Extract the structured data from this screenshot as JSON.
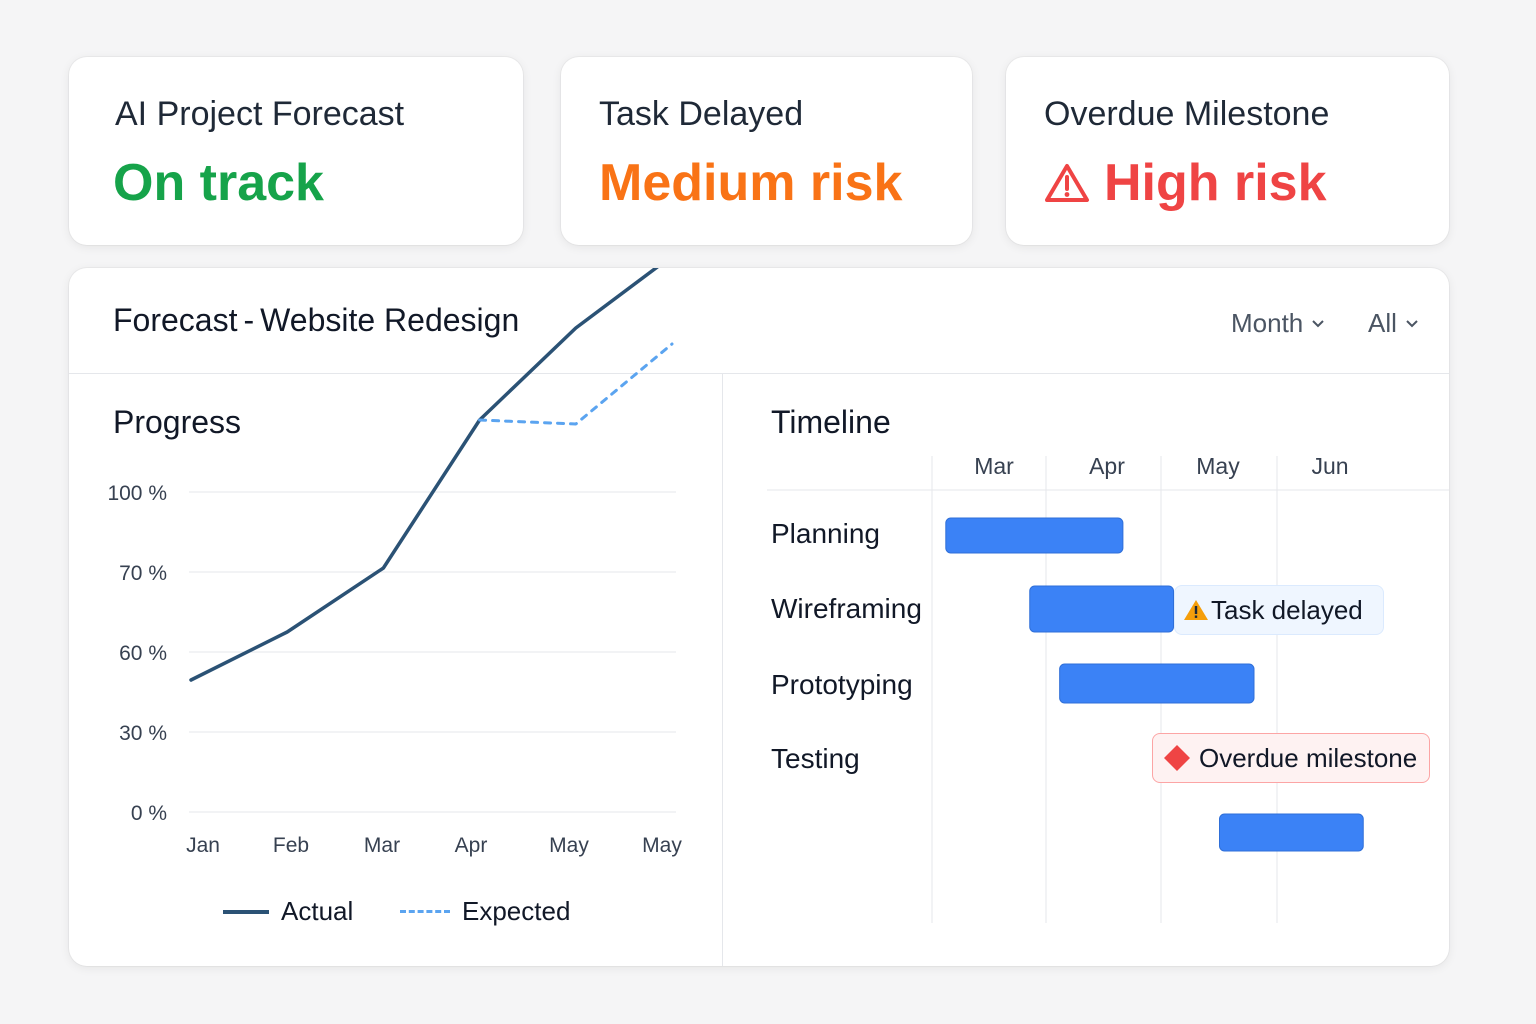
{
  "kpis": [
    {
      "title": "AI Project Forecast",
      "status": "On track",
      "color": "#16a34a",
      "icon": ""
    },
    {
      "title": "Task Delayed",
      "status": "Medium risk",
      "color": "#f97316",
      "icon": ""
    },
    {
      "title": "Overdue Milestone",
      "status": "High risk",
      "color": "#ef4444",
      "icon": "warning-triangle-icon"
    }
  ],
  "forecast": {
    "title_bold": "Forecast",
    "title_sep": "-",
    "title_project": "Website Redesign",
    "filters": {
      "period": "Month",
      "scope": "All"
    }
  },
  "progress": {
    "title": "Progress"
  },
  "timeline": {
    "title": "Timeline",
    "months": [
      "Mar",
      "Apr",
      "May",
      "Jun"
    ],
    "tasks": [
      {
        "label": "Planning",
        "start": 0.12,
        "end": 1.66
      },
      {
        "label": "Wireframing",
        "start": 0.85,
        "end": 2.1
      },
      {
        "label": "Prototyping",
        "start": 1.11,
        "end": 2.8
      },
      {
        "label": "Testing",
        "start": 2.5,
        "end": 3.75
      }
    ],
    "callouts": {
      "task_delayed": "Task delayed",
      "overdue_milestone": "Overdue milestone"
    }
  },
  "chart_data": {
    "type": "line",
    "title": "Progress",
    "categories": [
      "Jan",
      "Feb",
      "Mar",
      "Apr",
      "May",
      "May"
    ],
    "y_tick_labels": [
      "100 %",
      "70 %",
      "60 %",
      "30 %",
      "0 %"
    ],
    "series": [
      {
        "name": "Actual",
        "style": "solid",
        "color": "#2b5275",
        "values": [
          1.65,
          2.25,
          3.05,
          4.9,
          6.05,
          6.95
        ]
      },
      {
        "name": "Expected",
        "style": "dashed",
        "color": "#5ba4f0",
        "values": [
          null,
          null,
          null,
          4.9,
          4.85,
          5.85
        ]
      }
    ],
    "note": "values expressed as gridline index from bottom (0 = '0 %' line, 5 = '100 %' line, ticks are non-linear as printed)",
    "grid": true,
    "legend": "bottom"
  },
  "colors": {
    "bar": "#3b82f6",
    "warning_bg": "#eff6ff",
    "overdue_bg": "#fef2f2",
    "overdue_border": "#fca5a5"
  }
}
